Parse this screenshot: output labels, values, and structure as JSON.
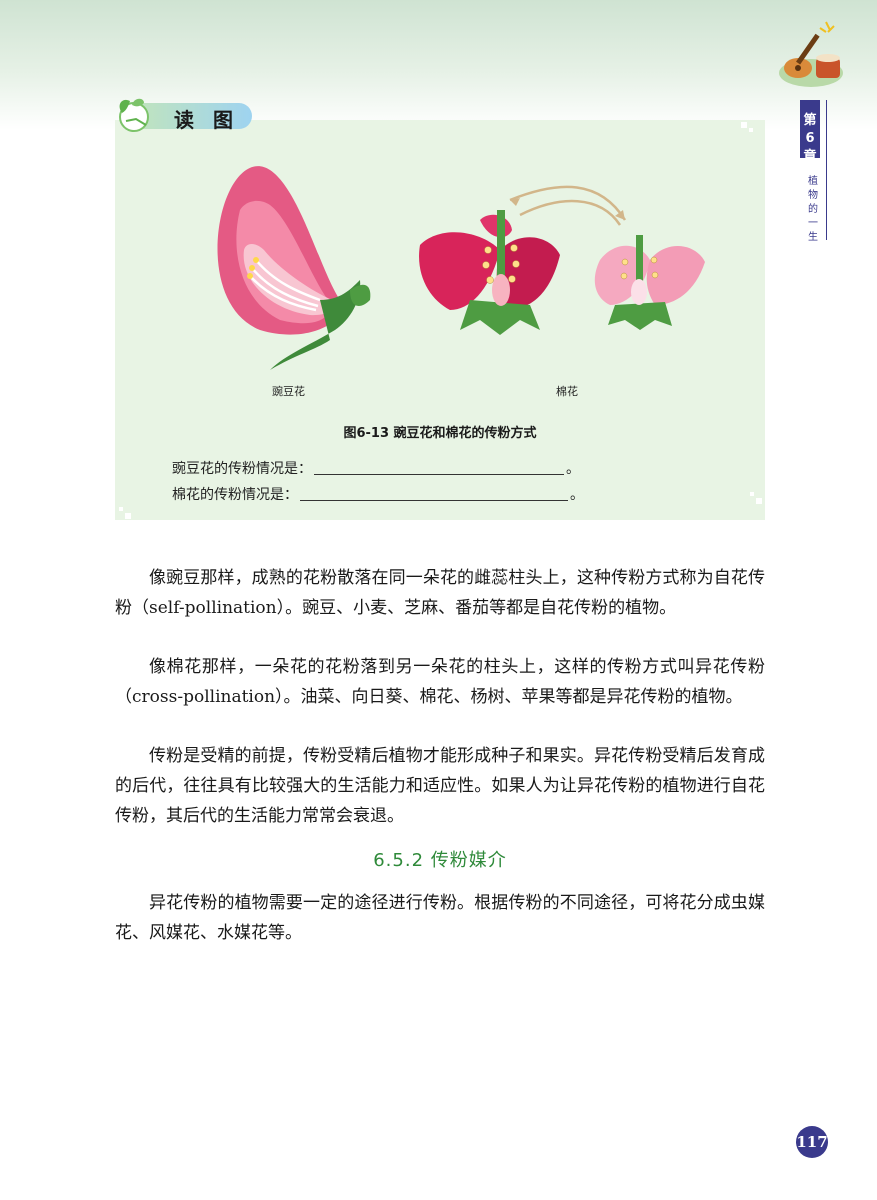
{
  "header": {
    "chapter_number": "第6章",
    "chapter_title": "植物的一生"
  },
  "read_box": {
    "title": "读 图",
    "label_pea": "豌豆花",
    "label_cotton": "棉花",
    "figure_caption": "图6-13 豌豆花和棉花的传粉方式",
    "fill_pea_prefix": "豌豆花的传粉情况是：",
    "fill_cotton_prefix": "棉花的传粉情况是：",
    "fill_suffix": "。"
  },
  "body": {
    "paragraphs": [
      "像豌豆那样，成熟的花粉散落在同一朵花的雌蕊柱头上，这种传粉方式称为自花传粉（self-pollination）。豌豆、小麦、芝麻、番茄等都是自花传粉的植物。",
      "像棉花那样，一朵花的花粉落到另一朵花的柱头上，这样的传粉方式叫异花传粉（cross-pollination）。油菜、向日葵、棉花、杨树、苹果等都是异花传粉的植物。",
      "传粉是受精的前提，传粉受精后植物才能形成种子和果实。异花传粉受精后发育成的后代，往往具有比较强大的生活能力和适应性。如果人为让异花传粉的植物进行自花传粉，其后代的生活能力常常会衰退。"
    ],
    "section_heading": "6.5.2 传粉媒介",
    "section_paragraph": "异花传粉的植物需要一定的途径进行传粉。根据传粉的不同途径，可将花分成虫媒花、风媒花、水媒花等。"
  },
  "footer": {
    "page_number": "117"
  },
  "colors": {
    "accent_blue": "#3a3a8c",
    "heading_green": "#2f8a3a",
    "box_bg": "#e8f4e4"
  }
}
